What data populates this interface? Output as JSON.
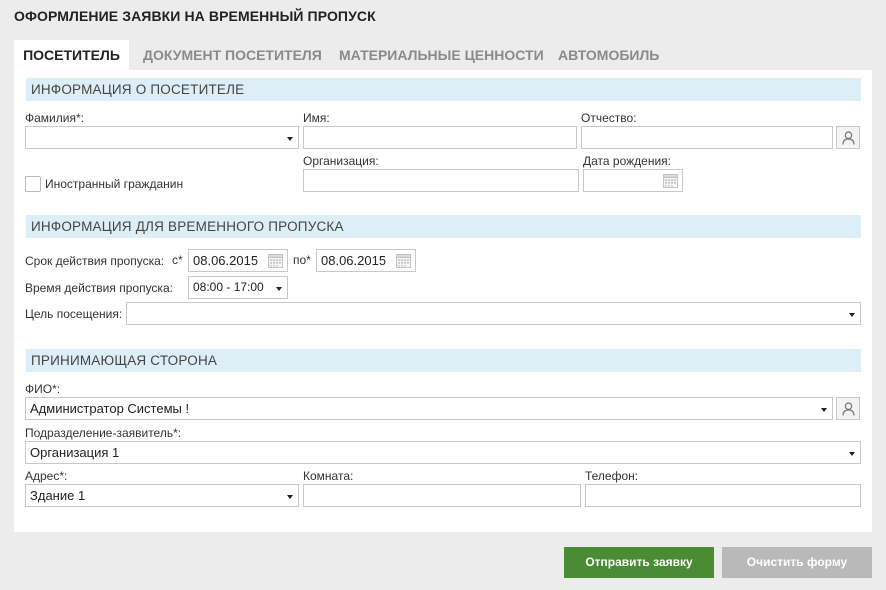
{
  "page": {
    "title": "ОФОРМЛЕНИЕ ЗАЯВКИ НА ВРЕМЕННЫЙ ПРОПУСК"
  },
  "tabs": [
    {
      "label": "ПОСЕТИТЕЛЬ",
      "active": true
    },
    {
      "label": "ДОКУМЕНТ ПОСЕТИТЕЛЯ",
      "active": false
    },
    {
      "label": "МАТЕРИАЛЬНЫЕ ЦЕННОСТИ",
      "active": false
    },
    {
      "label": "АВТОМОБИЛЬ",
      "active": false
    }
  ],
  "visitor": {
    "header": "ИНФОРМАЦИЯ О ПОСЕТИТЕЛЕ",
    "lastname_label": "Фамилия*:",
    "lastname_value": "",
    "firstname_label": "Имя:",
    "firstname_value": "",
    "patronymic_label": "Отчество:",
    "patronymic_value": "",
    "organization_label": "Организация:",
    "organization_value": "",
    "birthdate_label": "Дата рождения:",
    "birthdate_value": "",
    "foreigner_label": "Иностранный гражданин",
    "foreigner_checked": false
  },
  "pass": {
    "header": "ИНФОРМАЦИЯ ДЛЯ ВРЕМЕННОГО ПРОПУСКА",
    "validity_label": "Срок действия пропуска:",
    "from_label": "с*",
    "from_value": "08.06.2015",
    "to_label": "по*",
    "to_value": "08.06.2015",
    "time_label": "Время действия пропуска:",
    "time_value": "08:00 - 17:00",
    "purpose_label": "Цель посещения:",
    "purpose_value": ""
  },
  "host": {
    "header": "ПРИНИМАЮЩАЯ СТОРОНА",
    "fio_label": "ФИО*:",
    "fio_value": "Администратор Системы !",
    "department_label": "Подразделение-заявитель*:",
    "department_value": "Организация 1",
    "address_label": "Адрес*:",
    "address_value": "Здание 1",
    "room_label": "Комната:",
    "room_value": "",
    "phone_label": "Телефон:",
    "phone_value": ""
  },
  "actions": {
    "submit_label": "Отправить заявку",
    "clear_label": "Очистить форму"
  },
  "colors": {
    "section_header_bg": "#ddeef6",
    "submit_bg": "#4a8c33",
    "clear_bg": "#b9b9b9"
  }
}
